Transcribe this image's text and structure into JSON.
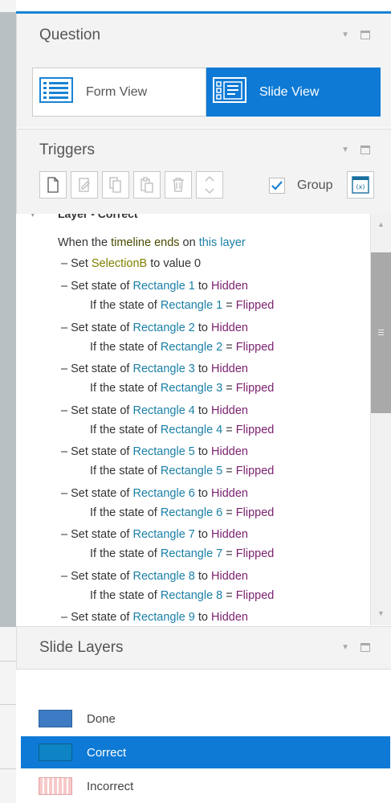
{
  "question_panel": {
    "title": "Question",
    "form_view_label": "Form View",
    "slide_view_label": "Slide View"
  },
  "triggers_panel": {
    "title": "Triggers",
    "group_label": "Group",
    "group_checked": true,
    "section_label": "Layer - Correct",
    "lines": {
      "l0": {
        "a": "When the ",
        "b": "timeline ends",
        "c": " on ",
        "d": "this layer"
      },
      "l1": {
        "a": "– Set ",
        "b": "SelectionB",
        "c": " to value 0"
      },
      "r1": {
        "set": "– Set state of ",
        "obj": "Rectangle 1",
        "to": " to ",
        "state": "Hidden",
        "if": "If the state of ",
        "eq": " = ",
        "cond": "Flipped"
      },
      "r2": {
        "set": "– Set state of ",
        "obj": "Rectangle 2",
        "to": " to ",
        "state": "Hidden",
        "if": "If the state of ",
        "eq": " = ",
        "cond": "Flipped"
      },
      "r3": {
        "set": "– Set state of ",
        "obj": "Rectangle 3",
        "to": " to ",
        "state": "Hidden",
        "if": "If the state of ",
        "eq": " = ",
        "cond": "Flipped"
      },
      "r4": {
        "set": "– Set state of ",
        "obj": "Rectangle 4",
        "to": " to ",
        "state": "Hidden",
        "if": "If the state of ",
        "eq": " = ",
        "cond": "Flipped"
      },
      "r5": {
        "set": "– Set state of ",
        "obj": "Rectangle 5",
        "to": " to ",
        "state": "Hidden",
        "if": "If the state of ",
        "eq": " = ",
        "cond": "Flipped"
      },
      "r6": {
        "set": "– Set state of ",
        "obj": "Rectangle 6",
        "to": " to ",
        "state": "Hidden",
        "if": "If the state of ",
        "eq": " = ",
        "cond": "Flipped"
      },
      "r7": {
        "set": "– Set state of ",
        "obj": "Rectangle 7",
        "to": " to ",
        "state": "Hidden",
        "if": "If the state of ",
        "eq": " = ",
        "cond": "Flipped"
      },
      "r8": {
        "set": "– Set state of ",
        "obj": "Rectangle 8",
        "to": " to ",
        "state": "Hidden",
        "if": "If the state of ",
        "eq": " = ",
        "cond": "Flipped"
      },
      "r9": {
        "set": "– Set state of ",
        "obj": "Rectangle 9",
        "to": " to ",
        "state": "Hidden"
      }
    }
  },
  "slide_layers_panel": {
    "title": "Slide Layers",
    "layers": [
      {
        "name": "Done"
      },
      {
        "name": "Correct",
        "selected": true
      },
      {
        "name": "Incorrect"
      }
    ]
  },
  "colors": {
    "accent": "#0e7ad5",
    "object": "#1a7fa6",
    "state": "#7a1f6e",
    "variable": "#808000"
  }
}
